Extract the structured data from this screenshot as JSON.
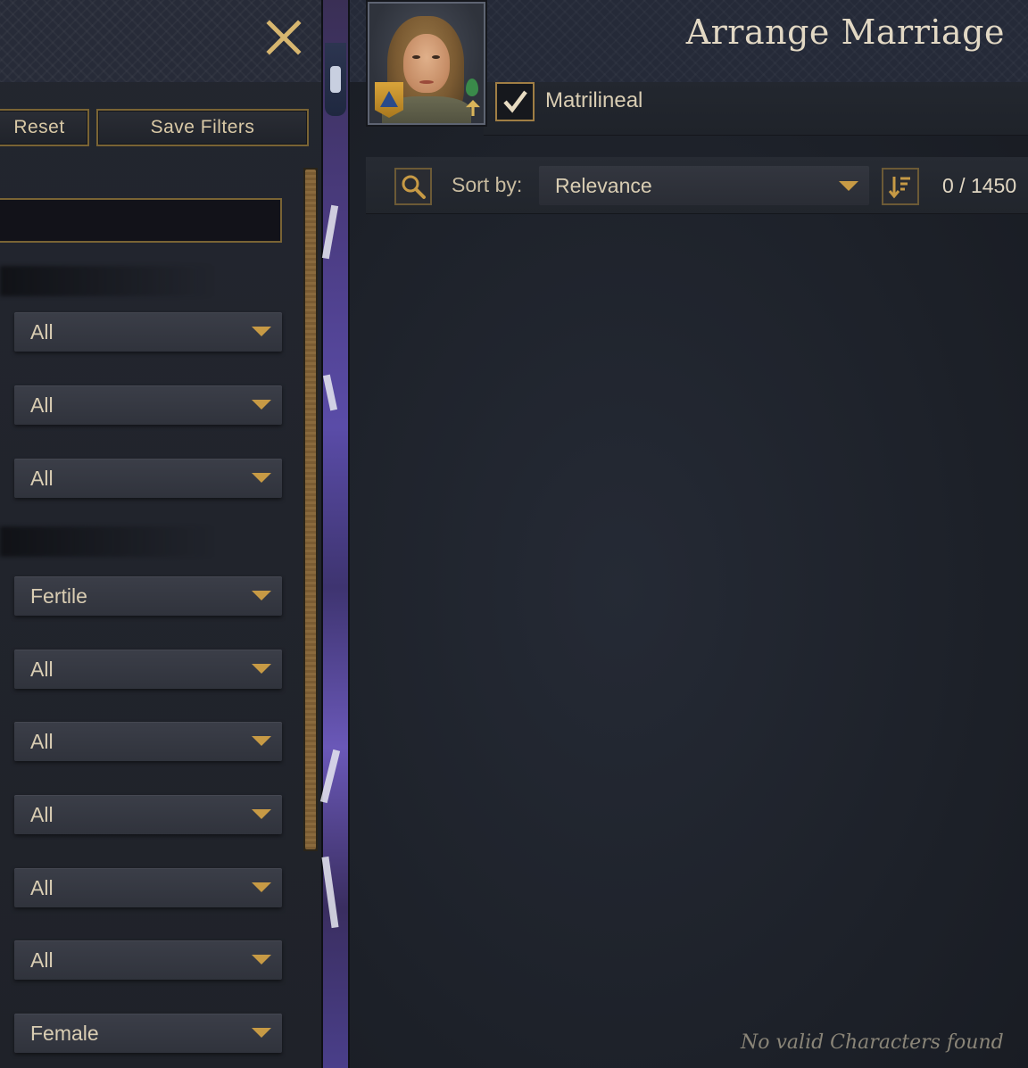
{
  "filter_panel": {
    "reset_label": "Reset",
    "save_filters_label": "Save Filters",
    "search_value": "",
    "dropdowns": [
      {
        "value": "All"
      },
      {
        "value": "All"
      },
      {
        "value": "All"
      },
      {
        "value": "Fertile"
      },
      {
        "value": "All"
      },
      {
        "value": "All"
      },
      {
        "value": "All"
      },
      {
        "value": "All"
      },
      {
        "value": "All"
      },
      {
        "value": "Female"
      }
    ]
  },
  "marriage_panel": {
    "title": "Arrange Marriage",
    "matrilineal_label": "Matrilineal",
    "matrilineal_checked": true,
    "sort_label": "Sort by:",
    "sort_value": "Relevance",
    "count": "0 / 1450",
    "empty_message": "No valid Characters found"
  },
  "colors": {
    "accent_gold": "#c79a45",
    "panel_bg": "#1f2229",
    "text": "#d9cdb3"
  },
  "icons": [
    "close-icon",
    "search-icon",
    "sort-order-icon",
    "checkmark-icon",
    "coat-of-arms-icon",
    "dread-icon",
    "dynasty-tree-icon"
  ]
}
